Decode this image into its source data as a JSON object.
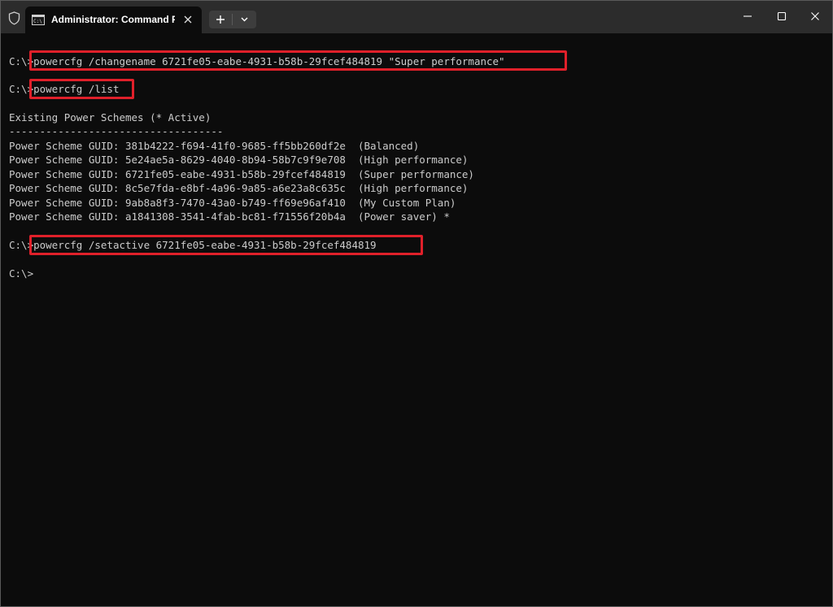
{
  "window": {
    "tab_title": "Administrator: Command Pro",
    "tab_icon": "command-prompt-icon",
    "shield_icon": "shield-icon",
    "new_tab_icon": "plus-icon",
    "dropdown_icon": "chevron-down-icon",
    "minimize_icon": "minimize-icon",
    "maximize_icon": "maximize-icon",
    "close_icon": "close-icon"
  },
  "console": {
    "prompt": "C:\\>",
    "lines": [
      {
        "prompt": "C:\\>",
        "command": "powercfg /changename 6721fe05-eabe-4931-b58b-29fcef484819 \"Super performance\""
      },
      {
        "prompt": "C:\\>",
        "command": "powercfg /list"
      },
      {
        "text": "Existing Power Schemes (* Active)"
      },
      {
        "text": "-----------------------------------"
      },
      {
        "text": "Power Scheme GUID: 381b4222-f694-41f0-9685-ff5bb260df2e  (Balanced)"
      },
      {
        "text": "Power Scheme GUID: 5e24ae5a-8629-4040-8b94-58b7c9f9e708  (High performance)"
      },
      {
        "text": "Power Scheme GUID: 6721fe05-eabe-4931-b58b-29fcef484819  (Super performance)"
      },
      {
        "text": "Power Scheme GUID: 8c5e7fda-e8bf-4a96-9a85-a6e23a8c635c  (High performance)"
      },
      {
        "text": "Power Scheme GUID: 9ab8a8f3-7470-43a0-b749-ff69e96af410  (My Custom Plan)"
      },
      {
        "text": "Power Scheme GUID: a1841308-3541-4fab-bc81-f71556f20b4a  (Power saver) *"
      },
      {
        "prompt": "C:\\>",
        "command": "powercfg /setactive 6721fe05-eabe-4931-b58b-29fcef484819"
      },
      {
        "prompt": "C:\\>",
        "command": ""
      }
    ]
  },
  "colors": {
    "terminal_bg": "#0c0c0c",
    "terminal_text": "#cccccc",
    "titlebar_bg": "#2c2c2c",
    "highlight": "#e0202a"
  }
}
